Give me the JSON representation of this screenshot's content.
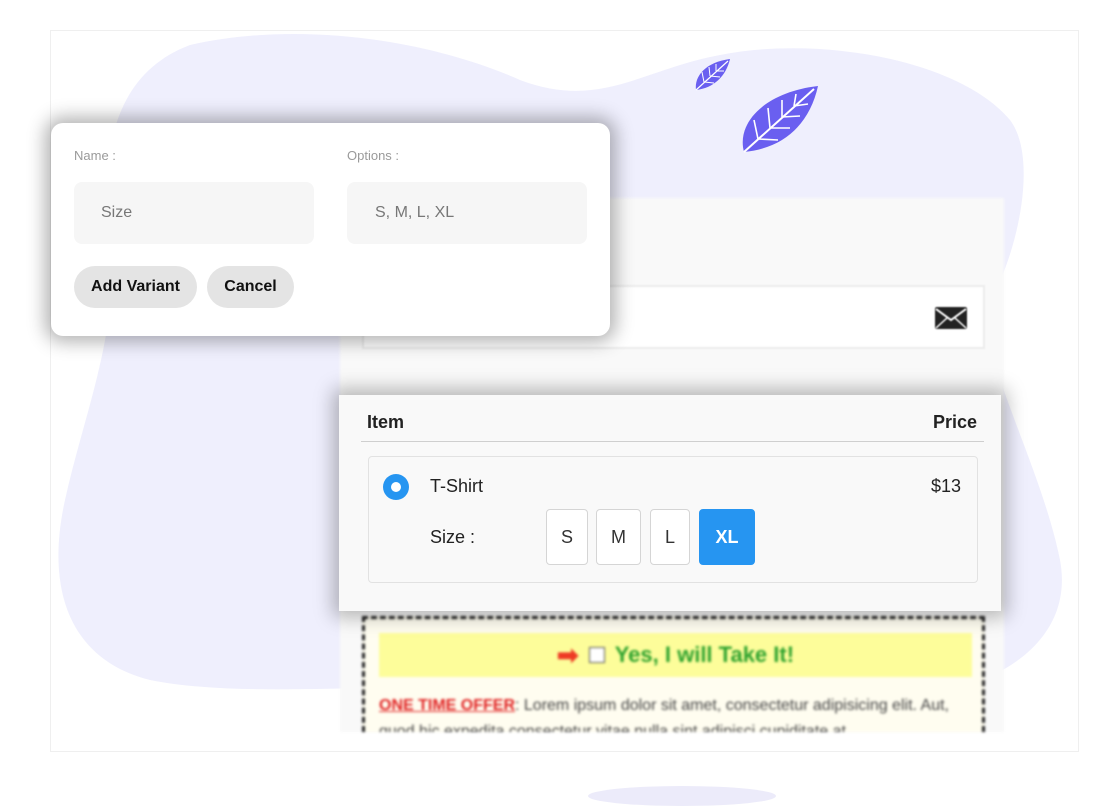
{
  "variant_form": {
    "name_label": "Name :",
    "name_value": "Size",
    "options_label": "Options :",
    "options_value": "S, M, L, XL",
    "add_button": "Add Variant",
    "cancel_button": "Cancel"
  },
  "checkout": {
    "email_icon": "envelope-icon",
    "table": {
      "header_item": "Item",
      "header_price": "Price"
    },
    "product": {
      "name": "T-Shirt",
      "price": "$13",
      "selected": true,
      "size_label": "Size :",
      "sizes": [
        "S",
        "M",
        "L",
        "XL"
      ],
      "selected_size": "XL"
    },
    "offer": {
      "headline": "Yes, I will Take It!",
      "label": "ONE TIME OFFER",
      "text": ": Lorem ipsum dolor sit amet, consectetur adipisicing elit. Aut, quod hic expedita consectetur vitae nulla sint adipisci cupiditate at"
    }
  },
  "colors": {
    "accent": "#2695f1",
    "blob": "#efeffd",
    "leaf": "#6a5ff0",
    "offer_headline": "#2da22d",
    "offer_label": "#e02020",
    "offer_bar": "#fdfd9a"
  }
}
